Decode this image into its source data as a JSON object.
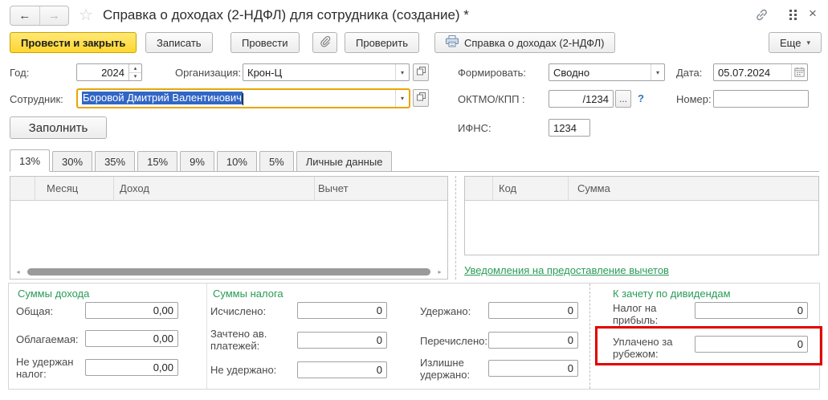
{
  "header": {
    "title": "Справка о доходах (2-НДФЛ) для сотрудника (создание) *"
  },
  "icons": {
    "back": "←",
    "forward": "→",
    "star": "☆",
    "close": "×",
    "dropdown": "▾",
    "spin_up": "▴",
    "spin_down": "▾",
    "more_dots": "...",
    "help": "?",
    "scroll_left": "◂",
    "scroll_right": "▸"
  },
  "toolbar": {
    "post_and_close": "Провести и закрыть",
    "save": "Записать",
    "post": "Провести",
    "check": "Проверить",
    "print_certificate": "Справка о доходах (2-НДФЛ)",
    "more": "Еще"
  },
  "form": {
    "year_label": "Год:",
    "year_value": "2024",
    "org_label": "Организация:",
    "org_value": "Крон-Ц",
    "generate_label": "Формировать:",
    "generate_value": "Сводно",
    "date_label": "Дата:",
    "date_value": "05.07.2024",
    "employee_label": "Сотрудник:",
    "employee_value": "Боровой Дмитрий Валентинович",
    "oktmo_label": "ОКТМО/КПП :",
    "oktmo_value": "/1234",
    "number_label": "Номер:",
    "number_value": "",
    "ifns_label": "ИФНС:",
    "ifns_value": "1234",
    "fill_button": "Заполнить"
  },
  "tabs": [
    {
      "label": "13%"
    },
    {
      "label": "30%"
    },
    {
      "label": "35%"
    },
    {
      "label": "15%"
    },
    {
      "label": "9%"
    },
    {
      "label": "10%"
    },
    {
      "label": "5%"
    },
    {
      "label": "Личные данные"
    }
  ],
  "income_table": {
    "col_month": "Месяц",
    "col_income": "Доход",
    "col_deduction": "Вычет"
  },
  "codes_table": {
    "col_code": "Код",
    "col_sum": "Сумма"
  },
  "notifications_link": "Уведомления на предоставление вычетов",
  "totals": {
    "income_title": "Суммы дохода",
    "income_rows": [
      {
        "label": "Общая:",
        "value": "0,00"
      },
      {
        "label": "Облагаемая:",
        "value": "0,00"
      },
      {
        "label": "Не удержан налог:",
        "value": "0,00"
      }
    ],
    "tax_title": "Суммы налога",
    "tax_rows": [
      {
        "label": "Исчислено:",
        "value": "0"
      },
      {
        "label": "Зачтено ав. платежей:",
        "value": "0"
      },
      {
        "label": "Не удержано:",
        "value": "0"
      }
    ],
    "withheld_rows": [
      {
        "label": "Удержано:",
        "value": "0"
      },
      {
        "label": "Перечислено:",
        "value": "0"
      },
      {
        "label": "Излишне удержано:",
        "value": "0"
      }
    ],
    "dividends_title": "К зачету по дивидендам",
    "dividend_rows": [
      {
        "label": "Налог на прибыль:",
        "value": "0"
      },
      {
        "label": "Уплачено за рубежом:",
        "value": "0"
      }
    ]
  },
  "colors": {
    "primary_button_yellow": "#ffd62e",
    "green_accent": "#2a9b57",
    "selection_blue": "#3166c5",
    "focus_border_orange": "#e8a600",
    "highlight_red": "#e20000"
  }
}
